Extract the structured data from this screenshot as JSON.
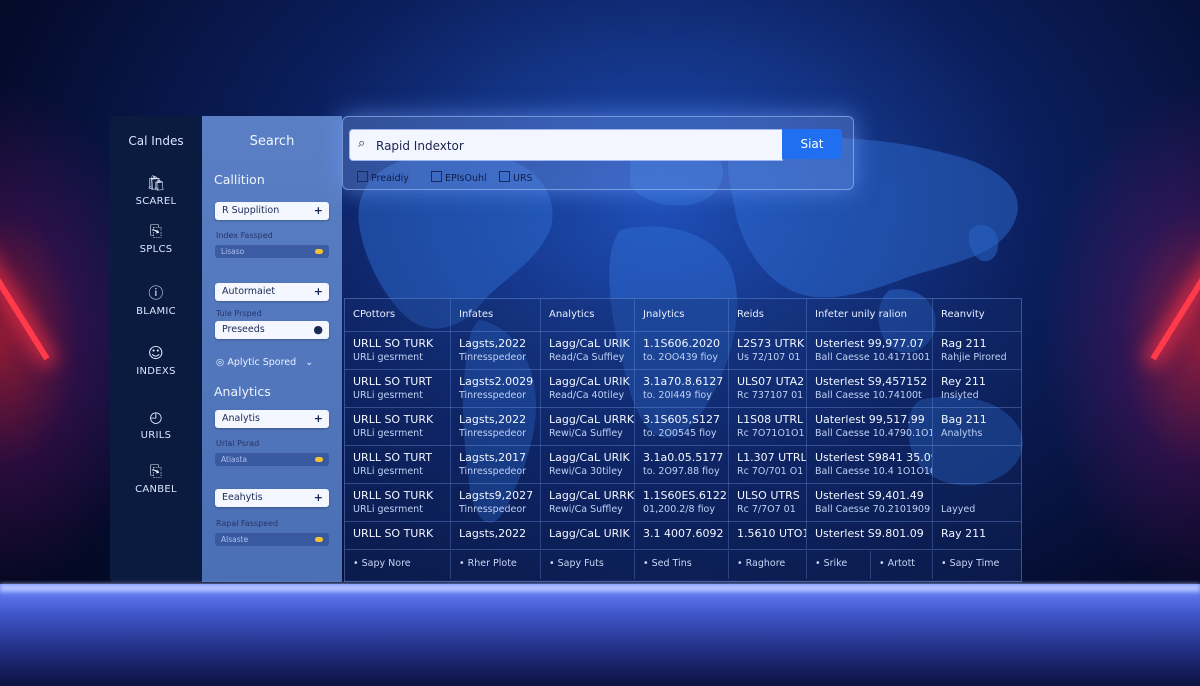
{
  "nav": {
    "title": "Cal Indes",
    "items": [
      {
        "label": "SCAREL",
        "icon": "bag-icon"
      },
      {
        "label": "SPLCS",
        "icon": "copy-icon"
      },
      {
        "label": "BLAMIC",
        "icon": "info-icon"
      },
      {
        "label": "INDEXS",
        "icon": "user-icon"
      },
      {
        "label": "URILS",
        "icon": "clock-icon"
      },
      {
        "label": "CANBEL",
        "icon": "tag-icon"
      }
    ]
  },
  "filters": {
    "title": "Search",
    "section_1": "Callition",
    "section_2": "Analytics",
    "btn_1": "R Supplition",
    "small_1": "Index Fassped",
    "bar_1": "Lisaso",
    "btn_2": "Autormaiet",
    "small_2": "Tule Prsped",
    "btn_3": "Preseeds",
    "toggle_1": "Aplytic Spored",
    "btn_4": "Analytis",
    "small_3": "Urlal Psrad",
    "bar_2": "Atiasta",
    "btn_5": "Eeahytis",
    "small_4": "Rapal Fasspeed",
    "bar_3": "Alsaste"
  },
  "search": {
    "value": "Rapid Indextor",
    "button": "Siat",
    "chips": [
      "Preaidiy",
      "EPIsOuhl",
      "URS"
    ]
  },
  "table": {
    "headers": [
      "CPottors",
      "Infates",
      "Analytics",
      "Jnalytics",
      "Reids",
      "Infeter unily ralion",
      "Reanvity"
    ],
    "rows": [
      [
        [
          "URLL SO TURK",
          "URLi gesrment"
        ],
        [
          "Lagsts,2022",
          "Tinresspedeor"
        ],
        [
          "Lagg/CaL URIK",
          "Read/Ca Suffiey"
        ],
        [
          "1.1S606.2020",
          "to. 2OO439 fioy"
        ],
        [
          "L2S73 UTRK",
          "Us 72/107 01"
        ],
        [
          "Usterlest 99,977.07",
          "Ball Caesse 10.4171001"
        ],
        [
          "Rag 211",
          "Rahjie Pirored"
        ]
      ],
      [
        [
          "URLL SO TURT",
          "URLi gesrment"
        ],
        [
          "Lagsts2.0029",
          "Tinresspedeor"
        ],
        [
          "Lagg/CaL URIK",
          "Read/Ca 40tiley"
        ],
        [
          "3.1a70.8.6127",
          "to. 20I449 fioy"
        ],
        [
          "ULS07 UTA2",
          "Rc 737107 01"
        ],
        [
          "Usterlest S9,457152",
          "Ball Caesse 10.74100t"
        ],
        [
          "Rey 211",
          "Insiyted"
        ]
      ],
      [
        [
          "URLL SO TURK",
          "URLi gesrment"
        ],
        [
          "Lagsts,2022",
          "Tinresspedeor"
        ],
        [
          "Lagg/CaL URRK",
          "Rewi/Ca Suffley"
        ],
        [
          "3.1S605,S127",
          "to. 2O0545 fioy"
        ],
        [
          "L1S08 UTRL",
          "Rc 7O71O1O1"
        ],
        [
          "Uaterlest 99,517.99",
          "Ball Caesse 10.4790.1O1"
        ],
        [
          "Bag 211",
          "Analyths"
        ]
      ],
      [
        [
          "URLL SO TURT",
          "URLi gesrment"
        ],
        [
          "Lagsts,2017",
          "Tinresspedeor"
        ],
        [
          "Lagg/CaL URIK",
          "Rewi/Ca 30tiley"
        ],
        [
          "3.1a0.05.5177",
          "to. 2O97.88 fioy"
        ],
        [
          "L1.307 UTRL",
          "Rc 7O/701 O1"
        ],
        [
          "Usterlest S9841 35.09",
          "Ball Caesse 10.4 1O1O1O1"
        ],
        [
          "",
          ""
        ]
      ],
      [
        [
          "URLL SO TURK",
          "URLi gesrment"
        ],
        [
          "Lagsts9,2027",
          "Tinresspedeor"
        ],
        [
          "Lagg/CaL URRK",
          "Rewi/Ca Suffley"
        ],
        [
          "1.1S60ES.6122",
          "01,200.2/8 fioy"
        ],
        [
          "ULSO UTRS",
          "Rc 7/7O7 01"
        ],
        [
          "Usterlest S9,401.49",
          "Ball Caesse 70.2101909"
        ],
        [
          "",
          "Layyed"
        ]
      ],
      [
        [
          "URLL SO TURK",
          ""
        ],
        [
          "Lagsts,2022",
          ""
        ],
        [
          "Lagg/CaL URIK",
          ""
        ],
        [
          "3.1 4007.6092",
          ""
        ],
        [
          "1.5610 UTO1",
          ""
        ],
        [
          "Usterlest S9.801.09",
          ""
        ],
        [
          "Ray 211",
          ""
        ]
      ]
    ],
    "footer": [
      "Sapy Nore",
      "Rher Plote",
      "Sapy Futs",
      "Sed Tins",
      "Raghore",
      "Srike",
      "Artott",
      "Sapy Time"
    ]
  },
  "colors": {
    "accent": "#1f6ff0",
    "nav_bg": "#0b1a3f",
    "panel_bg": "#5a7fc4",
    "neon": "#ff3a4a"
  }
}
